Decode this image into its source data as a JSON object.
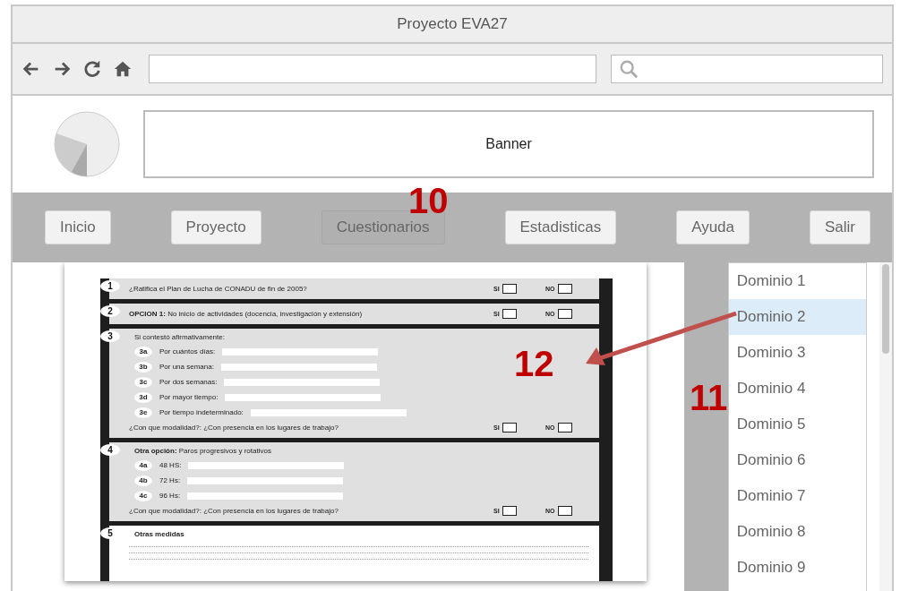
{
  "window": {
    "title": "Proyecto EVA27"
  },
  "header": {
    "banner": "Banner"
  },
  "nav": [
    {
      "label": "Inicio",
      "selected": false
    },
    {
      "label": "Proyecto",
      "selected": false
    },
    {
      "label": "Cuestionarios",
      "selected": true
    },
    {
      "label": "Estadisticas",
      "selected": false
    },
    {
      "label": "Ayuda",
      "selected": false
    },
    {
      "label": "Salir",
      "selected": false
    }
  ],
  "document": {
    "sections": [
      {
        "kind": "yesno",
        "number": "1",
        "text": "¿Ratifica el Plan de Lucha de CONADU de fin de 2005?",
        "yes": {
          "label": "SI",
          "checked": false
        },
        "no": {
          "label": "NO",
          "checked": false
        }
      },
      {
        "kind": "yesno",
        "number": "2",
        "text": "**OPCION 1:** No inicio de actividades (docencia, investigación y extensión)",
        "yes": {
          "label": "SI",
          "checked": false
        },
        "no": {
          "label": "NO",
          "checked": false
        }
      },
      {
        "kind": "fields",
        "number": "3",
        "heading": "Si contestó afirmativamente:",
        "items": [
          {
            "code": "3a",
            "label": "Por cuántos días:"
          },
          {
            "code": "3b",
            "label": "Por una semana:"
          },
          {
            "code": "3c",
            "label": "Por dos semanas:"
          },
          {
            "code": "3d",
            "label": "Por mayor tiempo:"
          },
          {
            "code": "3e",
            "label": "Por tiempo indeterminado:"
          }
        ],
        "question": "¿Con que modalidad?: ¿Con presencia en los lugares de trabajo?",
        "yes": {
          "label": "SI",
          "checked": false
        },
        "no": {
          "label": "NO",
          "checked": false
        }
      },
      {
        "kind": "fields",
        "number": "4",
        "heading": "**Otra opción:** Paros progresivos y rotativos",
        "items": [
          {
            "code": "4a",
            "label": "48 HS:"
          },
          {
            "code": "4b",
            "label": "72 Hs:"
          },
          {
            "code": "4c",
            "label": "96 Hs:"
          }
        ],
        "question": "¿Con que modalidad?: ¿Con presencia en los lugares de trabajo?",
        "yes": {
          "label": "SI",
          "checked": false
        },
        "no": {
          "label": "NO",
          "checked": false
        }
      },
      {
        "kind": "lines",
        "number": "5",
        "heading": "Otras medidas"
      }
    ]
  },
  "domains": [
    {
      "label": "Dominio 1",
      "selected": false
    },
    {
      "label": "Dominio 2",
      "selected": true
    },
    {
      "label": "Dominio 3",
      "selected": false
    },
    {
      "label": "Dominio 4",
      "selected": false
    },
    {
      "label": "Dominio 5",
      "selected": false
    },
    {
      "label": "Dominio 6",
      "selected": false
    },
    {
      "label": "Dominio 7",
      "selected": false
    },
    {
      "label": "Dominio 8",
      "selected": false
    },
    {
      "label": "Dominio 9",
      "selected": false
    }
  ],
  "annotations": [
    {
      "label": "10"
    },
    {
      "label": "11"
    },
    {
      "label": "12"
    }
  ]
}
